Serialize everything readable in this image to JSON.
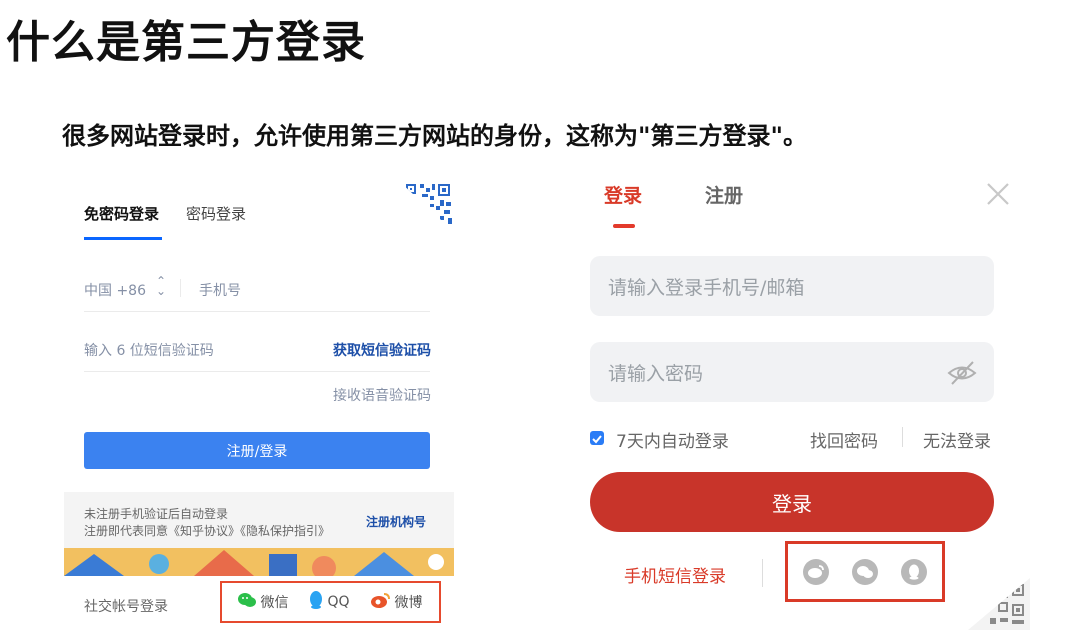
{
  "slide": {
    "title": "什么是第三方登录",
    "subtitle": "很多网站登录时，允许使用第三方网站的身份，这称为\"第三方登录\"。"
  },
  "left_panel": {
    "tabs": [
      "免密码登录",
      "密码登录"
    ],
    "country_code": "中国 +86",
    "phone_placeholder": "手机号",
    "code_placeholder": "输入 6 位短信验证码",
    "get_code_link": "获取短信验证码",
    "voice_code_link": "接收语音验证码",
    "submit_label": "注册/登录",
    "notice_line1": "未注册手机验证后自动登录",
    "notice_line2": "注册即代表同意《知乎协议》《隐私保护指引》",
    "org_register_link": "注册机构号",
    "social_label": "社交帐号登录",
    "social": {
      "wechat": "微信",
      "qq": "QQ",
      "weibo": "微博"
    },
    "colors": {
      "accent": "#3b82f0",
      "link": "#175199",
      "highlight_border": "#e64a2e"
    }
  },
  "right_panel": {
    "tab_login": "登录",
    "tab_register": "注册",
    "account_placeholder": "请输入登录手机号/邮箱",
    "password_placeholder": "请输入密码",
    "remember_label": "7天内自动登录",
    "remember_checked": true,
    "forgot_password": "找回密码",
    "cannot_login": "无法登录",
    "login_button": "登录",
    "sms_login": "手机短信登录",
    "social_icons": [
      "weibo-icon",
      "wechat-icon",
      "qq-icon"
    ],
    "colors": {
      "accent": "#c8342a",
      "field_bg": "#f1f2f4"
    }
  }
}
